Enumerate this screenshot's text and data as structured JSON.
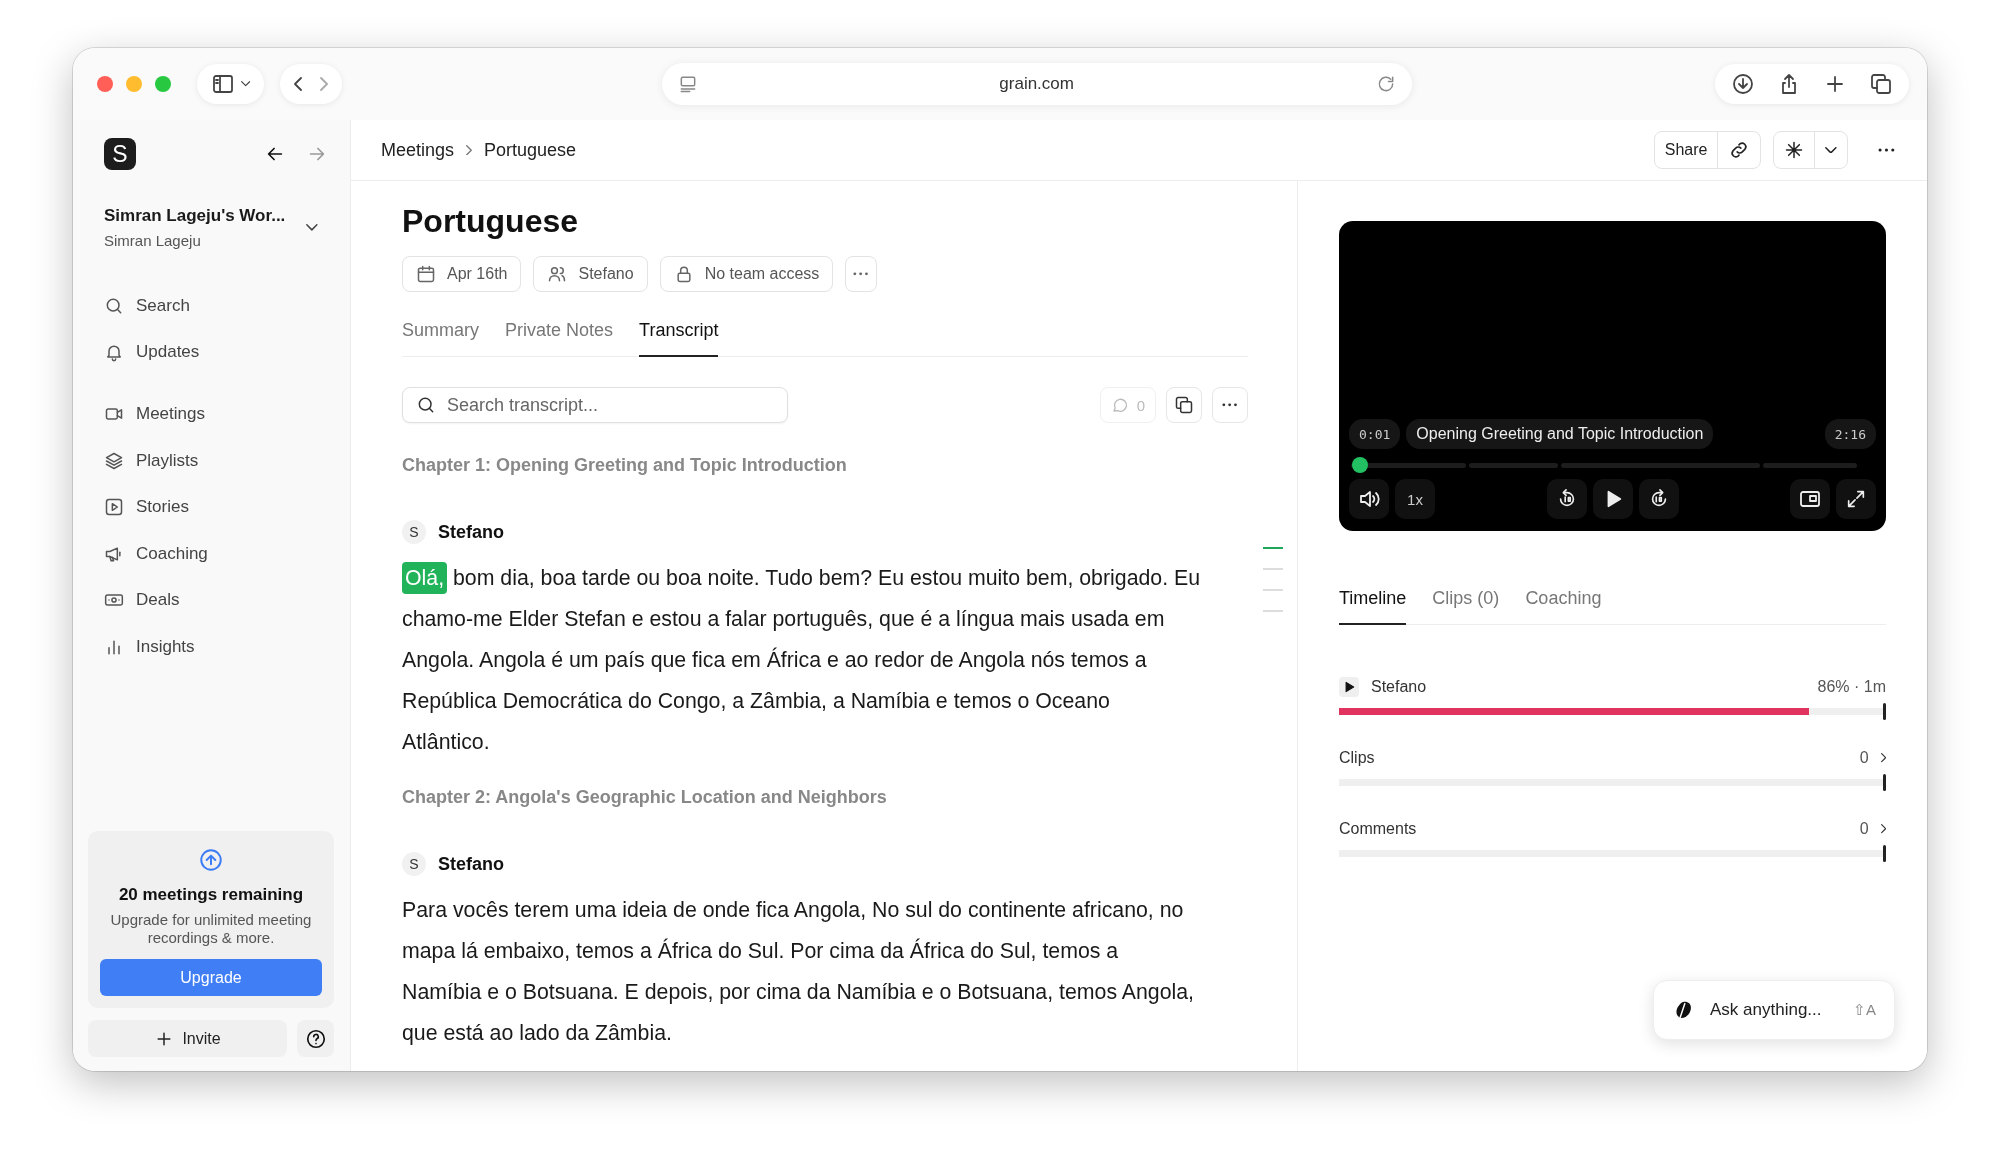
{
  "browser": {
    "url": "grain.com"
  },
  "sidebar": {
    "logo": "S",
    "workspace": {
      "name": "Simran Lageju's Wor...",
      "user": "Simran Lageju"
    },
    "nav_top": [
      {
        "label": "Search"
      },
      {
        "label": "Updates"
      }
    ],
    "nav_main": [
      {
        "label": "Meetings"
      },
      {
        "label": "Playlists"
      },
      {
        "label": "Stories"
      },
      {
        "label": "Coaching"
      },
      {
        "label": "Deals"
      },
      {
        "label": "Insights"
      }
    ],
    "upgrade": {
      "title": "20 meetings remaining",
      "text": "Upgrade for unlimited meeting recordings & more.",
      "button": "Upgrade"
    },
    "invite": "Invite"
  },
  "breadcrumb": [
    "Meetings",
    "Portuguese"
  ],
  "header_actions": {
    "share": "Share"
  },
  "meeting": {
    "title": "Portuguese",
    "chips": [
      "Apr 16th",
      "Stefano",
      "No team access"
    ]
  },
  "tabs": [
    {
      "label": "Summary",
      "selected": false
    },
    {
      "label": "Private Notes",
      "selected": false
    },
    {
      "label": "Transcript",
      "selected": true
    }
  ],
  "transcript": {
    "search_placeholder": "Search transcript...",
    "comment_count": "0",
    "sections": [
      {
        "chapter": "Chapter 1: Opening Greeting and Topic Introduction",
        "initial": "S",
        "speaker": "Stefano",
        "highlight": "Olá,",
        "text": "bom dia, boa tarde ou boa noite. Tudo bem? Eu estou muito bem, obrigado. Eu chamo-me Elder Stefan e estou a falar português, que é a língua mais usada em Angola. Angola é um país que fica em África e ao redor de Angola nós temos a República Democrática do Congo, a Zâmbia, a Namíbia e temos o Oceano Atlântico."
      },
      {
        "chapter": "Chapter 2: Angola's Geographic Location and Neighbors",
        "initial": "S",
        "speaker": "Stefano",
        "text": "Para vocês terem uma ideia de onde fica Angola, No sul do continente africano, no mapa lá embaixo, temos a África do Sul. Por cima da África do Sul, temos a Namíbia e o Botsuana. E depois, por cima da Namíbia e o Botsuana, temos Angola, que está ao lado da Zâmbia."
      }
    ]
  },
  "minimap": [
    {
      "selected": true
    },
    {
      "selected": false
    },
    {
      "selected": false
    },
    {
      "selected": false
    }
  ],
  "player": {
    "current_time": "0:01",
    "chapter": "Opening Greeting and Topic Introduction",
    "duration": "2:16",
    "speed": "1x",
    "level": 0.01
  },
  "panel_tabs": [
    {
      "label": "Timeline",
      "selected": true
    },
    {
      "label": "Clips (0)",
      "selected": false
    },
    {
      "label": "Coaching",
      "selected": false
    }
  ],
  "timeline": [
    {
      "kind": "speaker",
      "label": "Stefano",
      "value": "86% · 1m",
      "level": 0.86
    },
    {
      "kind": "count",
      "label": "Clips",
      "value": "0"
    },
    {
      "kind": "count",
      "label": "Comments",
      "value": "0"
    }
  ],
  "assistant": {
    "placeholder": "Ask anything...",
    "shortcut": "⇧A"
  }
}
